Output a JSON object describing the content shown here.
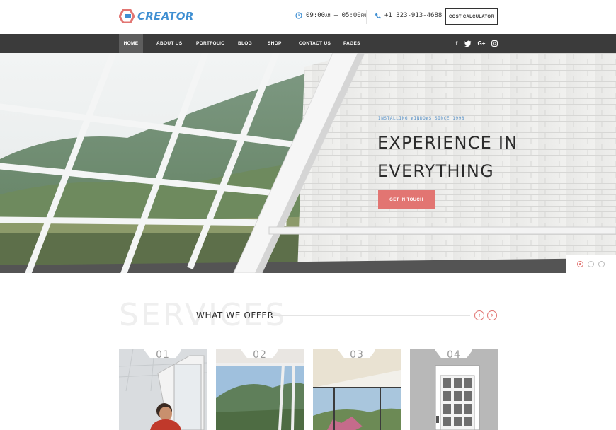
{
  "brand": {
    "name": "CREATOR"
  },
  "header": {
    "hours_open": "09:00",
    "hours_open_suffix": "AM",
    "hours_dash": "—",
    "hours_close": "05:00",
    "hours_close_suffix": "PM",
    "phone": "+1 323-913-4688",
    "cost_button": "COST CALCULATOR"
  },
  "nav": {
    "items": [
      "HOME",
      "ABOUT US",
      "PORTFOLIO",
      "BLOG",
      "SHOP",
      "CONTACT US",
      "PAGES"
    ],
    "active": "HOME",
    "social": [
      "f",
      "t",
      "G+",
      "ig"
    ]
  },
  "hero": {
    "subtitle": "INSTALLING WINDOWS SINCE 1998",
    "title_line1": "EXPERIENCE IN",
    "title_line2": "EVERYTHING",
    "button": "GET IN TOUCH",
    "slides": 3,
    "active_slide": 1
  },
  "services": {
    "bg_word": "SERVICES",
    "title": "WHAT WE OFFER",
    "prev_icon": "‹",
    "next_icon": "›",
    "cards": [
      {
        "num": "01"
      },
      {
        "num": "02"
      },
      {
        "num": "03"
      },
      {
        "num": "04"
      }
    ]
  },
  "colors": {
    "accent": "#e27572",
    "brand_blue": "#3f8fd2",
    "nav_bg": "#3b3b3b",
    "nav_active": "#5d5d5d"
  }
}
